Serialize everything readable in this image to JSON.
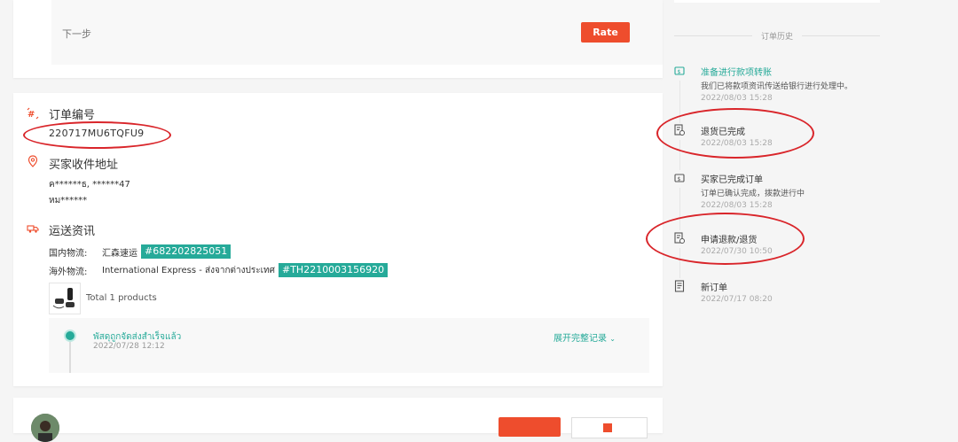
{
  "top": {
    "next_label": "下一步",
    "rate_label": "Rate"
  },
  "order": {
    "title": "订单编号",
    "id": "220717MU6TQFU9"
  },
  "address": {
    "title": "买家收件地址",
    "name": "ค******ธ, ******47",
    "line2": "หม******"
  },
  "shipping": {
    "title": "运送资讯",
    "domestic_label": "国内物流:",
    "domestic_carrier": "汇森速运",
    "domestic_tracking": "#682202825051",
    "intl_label": "海外物流:",
    "intl_carrier": "International Express - ส่งจากต่างประเทศ",
    "intl_tracking": "#TH2210003156920",
    "products_total": "Total 1 products",
    "track_status": "พัสดุถูกจัดส่งสำเร็จแล้ว",
    "track_time": "2022/07/28 12:12",
    "track_expand": "展开完整记录"
  },
  "bottom": {
    "seller": "",
    "chat_label": "",
    "shop_label": ""
  },
  "history": {
    "title": "订单历史",
    "items": [
      {
        "label": "准备进行款项转账",
        "desc": "我们已将款项资讯传送给银行进行处理中。",
        "time": "2022/08/03 15:28",
        "icon": "bank-transfer-icon"
      },
      {
        "label": "退货已完成",
        "desc": "",
        "time": "2022/08/03 15:28",
        "icon": "return-complete-icon"
      },
      {
        "label": "买家已完成订单",
        "desc": "订单已确认完成，拨款进行中",
        "time": "2022/08/03 15:28",
        "icon": "order-complete-icon"
      },
      {
        "label": "申请退款/退货",
        "desc": "",
        "time": "2022/07/30 10:50",
        "icon": "refund-request-icon"
      },
      {
        "label": "新订单",
        "desc": "",
        "time": "2022/07/17 08:20",
        "icon": "new-order-icon"
      }
    ]
  },
  "colors": {
    "accent": "#ee4d2d",
    "teal": "#26aa99",
    "annotation": "#d9252a"
  }
}
